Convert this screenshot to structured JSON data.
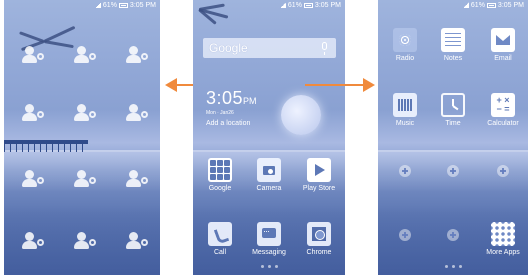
{
  "status_bar": {
    "battery": "61%",
    "time": "3:05 PM"
  },
  "colors": {
    "arrow": "#f08a3c",
    "wallpaper_tint": "#8aa1d2"
  },
  "center_screen": {
    "search": {
      "label": "Google"
    },
    "clock": {
      "time": "3:05",
      "ampm": "PM",
      "date": "Mon · Jan26",
      "add_location": "Add a location"
    },
    "apps": [
      {
        "label": "Google",
        "icon": "google-folder-icon"
      },
      {
        "label": "Camera",
        "icon": "camera-icon"
      },
      {
        "label": "Play Store",
        "icon": "play-store-icon"
      }
    ],
    "dock": [
      {
        "label": "Call",
        "icon": "phone-icon"
      },
      {
        "label": "Messaging",
        "icon": "message-icon"
      },
      {
        "label": "Chrome",
        "icon": "chrome-icon"
      }
    ]
  },
  "right_screen": {
    "apps": [
      {
        "label": "Radio",
        "icon": "radio-icon"
      },
      {
        "label": "Notes",
        "icon": "notes-icon"
      },
      {
        "label": "Email",
        "icon": "email-icon"
      },
      {
        "label": "Music",
        "icon": "music-icon"
      },
      {
        "label": "Time",
        "icon": "clock-icon"
      },
      {
        "label": "Calculator",
        "icon": "calculator-icon"
      }
    ],
    "more_apps": {
      "label": "More Apps",
      "icon": "grid-icon"
    }
  }
}
